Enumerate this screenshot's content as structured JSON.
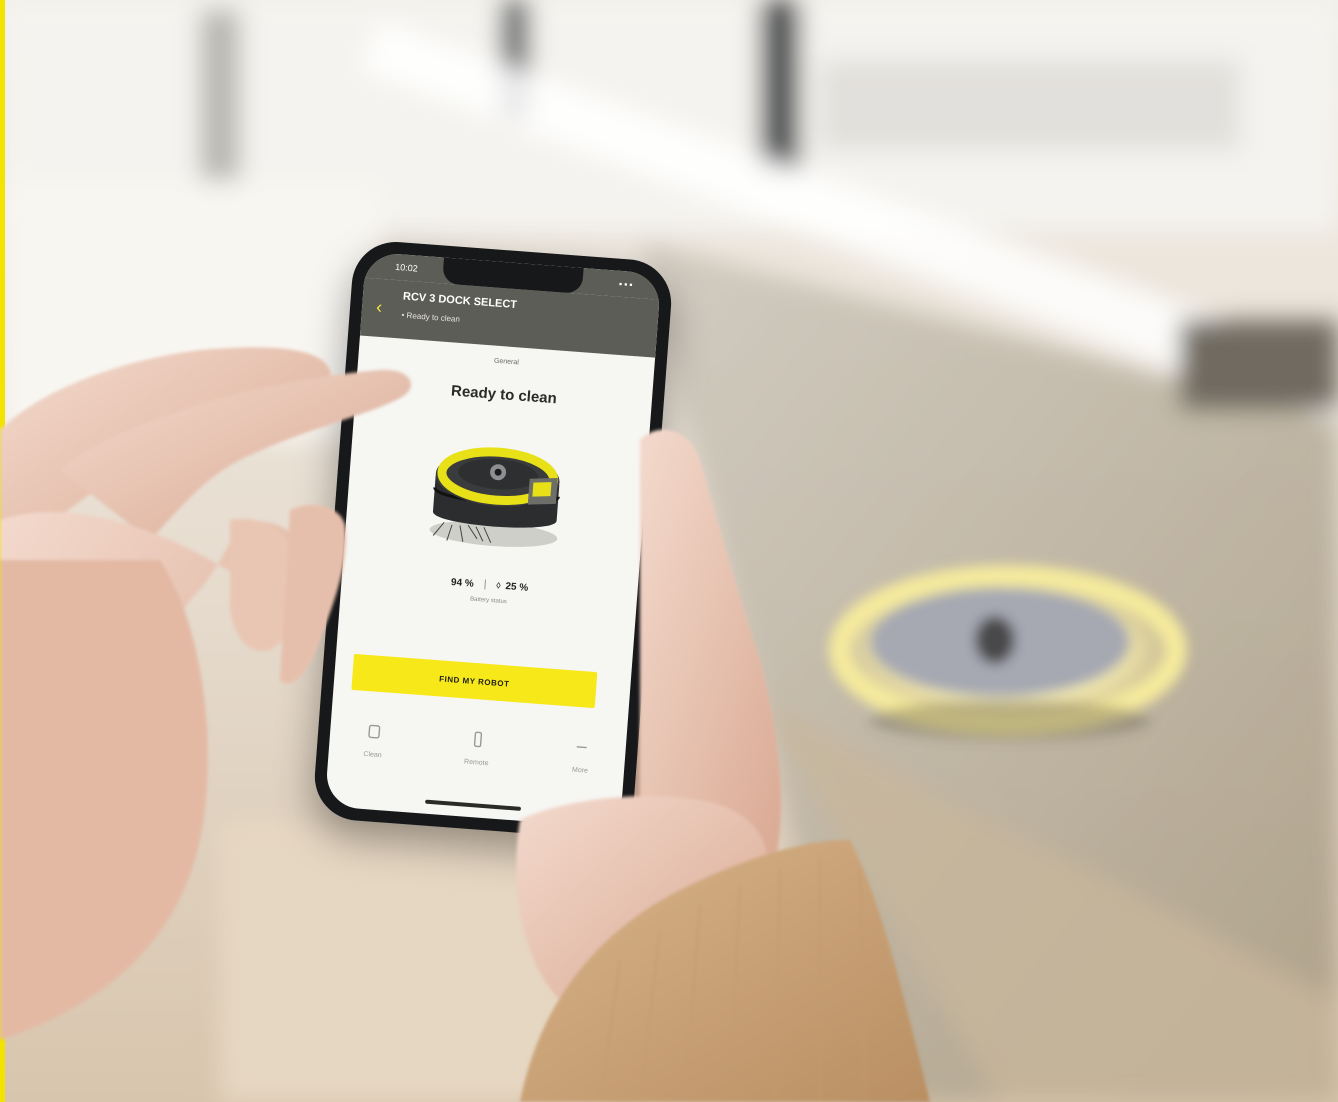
{
  "frame": {
    "accent_color": "#f2e300"
  },
  "phone": {
    "status_time": "10:02",
    "status_icons": "▪▪▪",
    "header": {
      "title": "RCV 3 DOCK SELECT",
      "subtitle": "• Ready to clean",
      "back_icon": "chevron-left-icon"
    },
    "mode_label": "General",
    "status_heading": "Ready to clean",
    "stats": {
      "battery": "94 %",
      "water": "25 %",
      "caption": "Battery status"
    },
    "primary_button": "FIND MY ROBOT",
    "tabs": [
      {
        "label": "Clean",
        "icon": "robot-icon"
      },
      {
        "label": "Remote",
        "icon": "remote-icon"
      },
      {
        "label": "More",
        "icon": "menu-icon"
      }
    ],
    "colors": {
      "header": "#5d5d57",
      "button": "#f7e81a",
      "robot_ring": "#e9e118"
    }
  }
}
